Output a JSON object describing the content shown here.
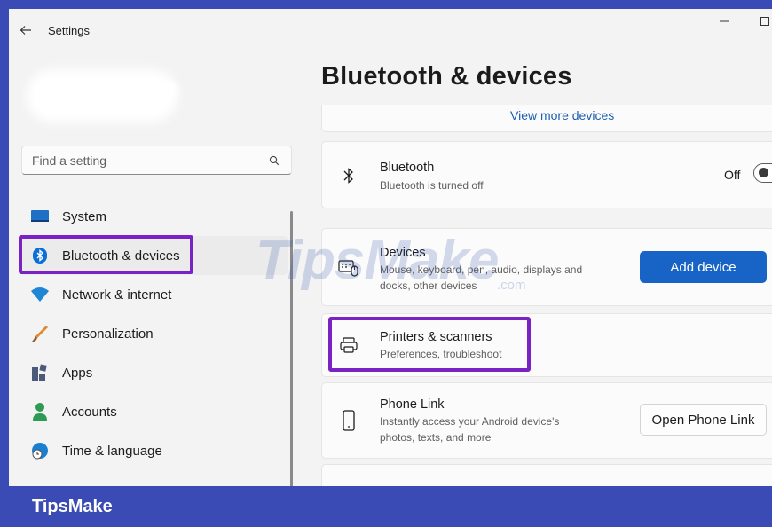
{
  "window": {
    "title": "Settings",
    "controls": [
      "minimize-icon",
      "maximize-icon"
    ]
  },
  "search": {
    "placeholder": "Find a setting",
    "value": ""
  },
  "sidebar": {
    "items": [
      {
        "label": "System",
        "icon": "system-monitor-icon",
        "color": "#1f6fc5"
      },
      {
        "label": "Bluetooth & devices",
        "icon": "bluetooth-icon",
        "color": "#0a6fd6",
        "selected": true
      },
      {
        "label": "Network & internet",
        "icon": "wifi-icon",
        "color": "#1f86d6"
      },
      {
        "label": "Personalization",
        "icon": "brush-icon",
        "color": "#e08a2d"
      },
      {
        "label": "Apps",
        "icon": "apps-icon",
        "color": "#4a5a78"
      },
      {
        "label": "Accounts",
        "icon": "person-icon",
        "color": "#2e9b55"
      },
      {
        "label": "Time & language",
        "icon": "globe-clock-icon",
        "color": "#1b7fd0"
      }
    ]
  },
  "main": {
    "title": "Bluetooth & devices",
    "view_more": "View more devices",
    "bluetooth": {
      "title": "Bluetooth",
      "subtitle": "Bluetooth is turned off",
      "toggle_label": "Off"
    },
    "devices": {
      "title": "Devices",
      "subtitle_line1": "Mouse, keyboard, pen, audio, displays and",
      "subtitle_line2": "docks, other devices",
      "button": "Add device"
    },
    "printers": {
      "title": "Printers & scanners",
      "subtitle": "Preferences, troubleshoot"
    },
    "phone_link": {
      "title": "Phone Link",
      "subtitle_line1": "Instantly access your Android device's",
      "subtitle_line2": "photos, texts, and more",
      "button": "Open Phone Link"
    }
  },
  "watermark": {
    "text": "TipsMake",
    "suffix": ".com"
  },
  "banner": {
    "text": "TipsMake"
  },
  "colors": {
    "accent": "#1763c6",
    "highlight": "#7a22c4",
    "banner": "#3b4bb5"
  }
}
